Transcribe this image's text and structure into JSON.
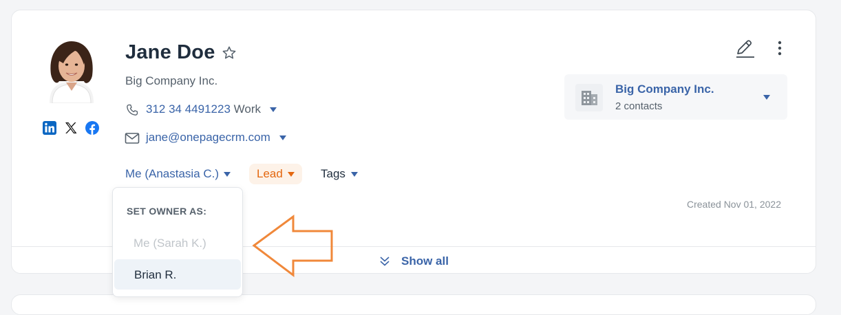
{
  "contact": {
    "name": "Jane Doe",
    "company": "Big Company Inc.",
    "phone": "312 34 4491223",
    "phone_type": "Work",
    "email": "jane@onepagecrm.com",
    "owner": "Me (Anastasia C.)",
    "status": "Lead",
    "tags_label": "Tags",
    "created": "Created Nov 01, 2022"
  },
  "company_card": {
    "name": "Big Company Inc.",
    "contacts": "2 contacts"
  },
  "show_all_label": "Show all",
  "owner_dropdown": {
    "header": "SET OWNER AS:",
    "options": [
      "Me (Sarah K.)",
      "Brian R."
    ]
  },
  "icons": [
    "linkedin-icon",
    "x-icon",
    "facebook-icon",
    "star-icon",
    "phone-icon",
    "mail-icon",
    "edit-icon",
    "more-icon",
    "building-icon",
    "chevron-double-down-icon",
    "arrow-left-icon"
  ],
  "colors": {
    "accent": "#3a64a8",
    "lead": "#e4670f",
    "arrow": "#f0883a"
  }
}
